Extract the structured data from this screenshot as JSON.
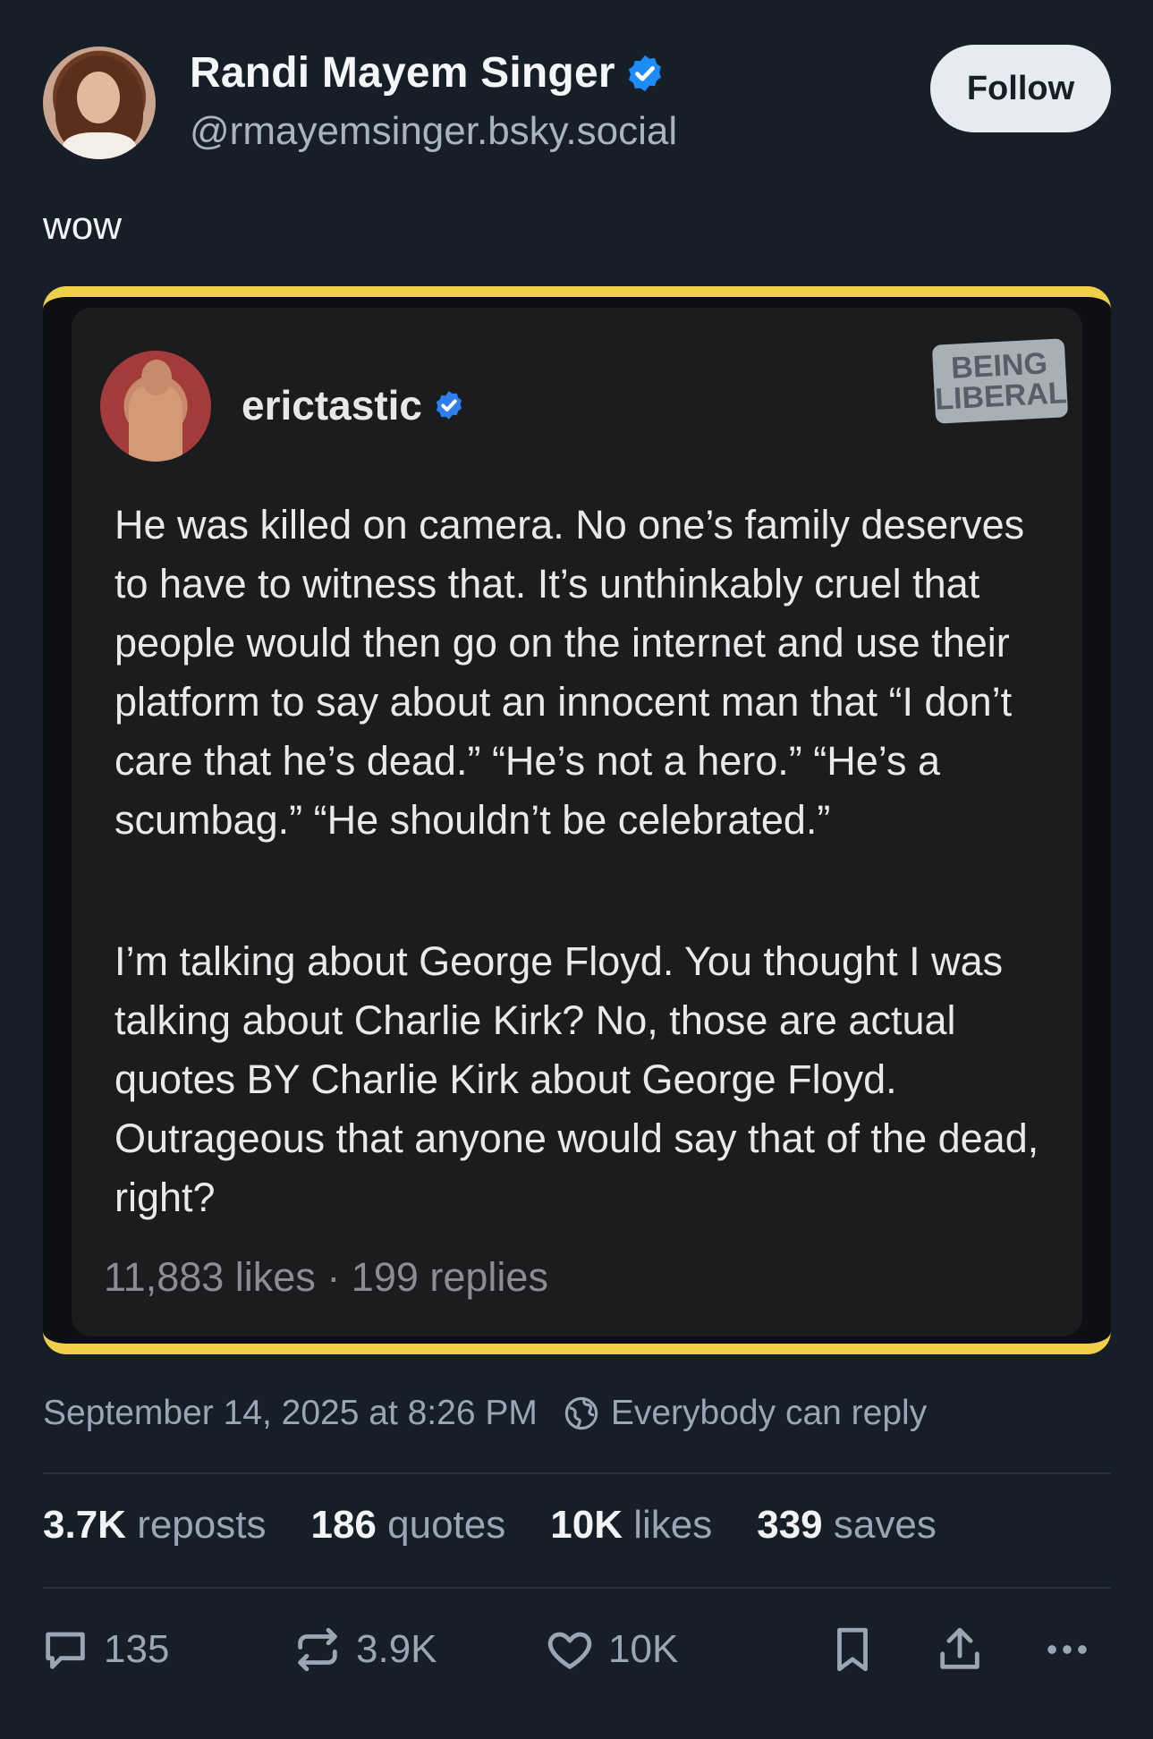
{
  "author": {
    "name": "Randi Mayem Singer",
    "handle": "@rmayemsinger.bsky.social",
    "follow_label": "Follow"
  },
  "post": {
    "text": "wow"
  },
  "embed": {
    "author": "erictastic",
    "watermark_line1": "BEING",
    "watermark_line2": "LIBERAL",
    "paragraph1": "He was killed on camera. No one’s family deserves to have to witness that. It’s unthinkably cruel that people would then go on the internet and use their platform to say about an innocent man that “I don’t care that he’s dead.” “He’s not a hero.” “He’s a scumbag.” “He shouldn’t be celebrated.”",
    "paragraph2": "I’m talking about George Floyd. You thought I was talking about Charlie Kirk? No, those are actual quotes BY Charlie Kirk about George Floyd. Outrageous that anyone would say that of the dead, right?",
    "stats": "11,883 likes · 199 replies"
  },
  "meta": {
    "timestamp": "September 14, 2025 at 8:26 PM",
    "reply_setting": "Everybody can reply"
  },
  "counts": [
    {
      "num": "3.7K",
      "label": "reposts"
    },
    {
      "num": "186",
      "label": "quotes"
    },
    {
      "num": "10K",
      "label": "likes"
    },
    {
      "num": "339",
      "label": "saves"
    }
  ],
  "actions": {
    "replies": "135",
    "reposts": "3.9K",
    "likes": "10K"
  },
  "colors": {
    "background": "#161e27",
    "verified": "#1d8cf8",
    "embed_border": "#f0d04a"
  },
  "icons": [
    "verified-badge-icon",
    "globe-icon",
    "reply-icon",
    "repost-icon",
    "like-icon",
    "bookmark-icon",
    "share-icon",
    "more-icon"
  ]
}
